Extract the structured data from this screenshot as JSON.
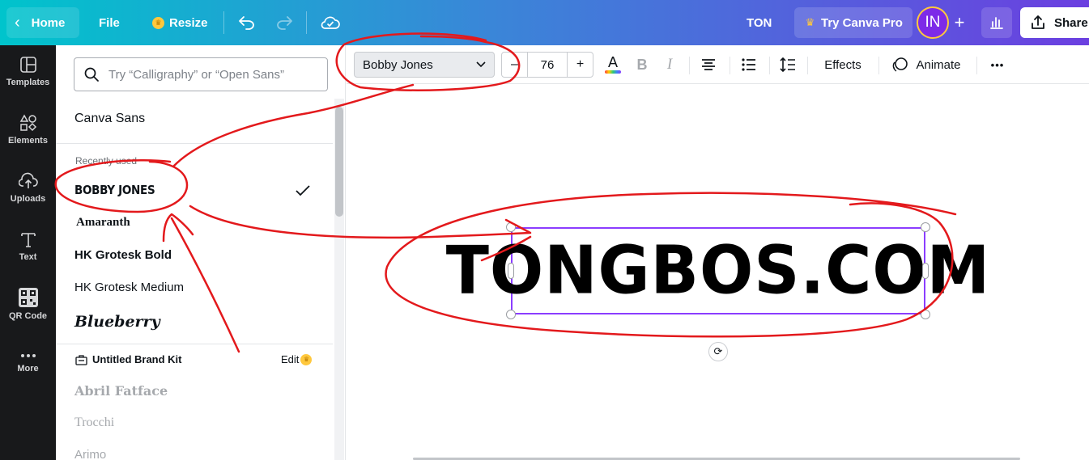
{
  "topbar": {
    "home_label": "Home",
    "file_label": "File",
    "resize_label": "Resize",
    "title": "TON",
    "try_pro_label": "Try Canva Pro",
    "avatar_initials": "IN",
    "share_label": "Share"
  },
  "rail": {
    "items": [
      {
        "label": "Templates",
        "icon": "templates-icon"
      },
      {
        "label": "Elements",
        "icon": "elements-icon"
      },
      {
        "label": "Uploads",
        "icon": "uploads-icon"
      },
      {
        "label": "Text",
        "icon": "text-icon"
      },
      {
        "label": "QR Code",
        "icon": "qr-code-icon"
      },
      {
        "label": "More",
        "icon": "more-icon"
      }
    ]
  },
  "font_panel": {
    "search_placeholder": "Try “Calligraphy” or “Open Sans”",
    "default_font": "Canva Sans",
    "recently_used_label": "Recently used",
    "recent_fonts": [
      "BOBBY JONES",
      "Amaranth",
      "HK Grotesk Bold",
      "HK Grotesk Medium",
      "Blueberry"
    ],
    "brand_kit_label": "Untitled Brand Kit",
    "brand_kit_edit": "Edit",
    "more_fonts": [
      "Abril Fatface",
      "Trocchi",
      "Arimo"
    ]
  },
  "toolbar": {
    "font_name": "Bobby Jones",
    "font_size": "76",
    "minus_label": "–",
    "plus_label": "+",
    "effects_label": "Effects",
    "animate_label": "Animate",
    "bold_label": "B",
    "italic_label": "I",
    "text_color_label": "A",
    "more_label": "•••"
  },
  "canvas": {
    "text": "TONGBOS.COM"
  },
  "colors": {
    "accent": "#8b3dff",
    "annotation": "#e3191c",
    "crown": "#ffc83d"
  }
}
